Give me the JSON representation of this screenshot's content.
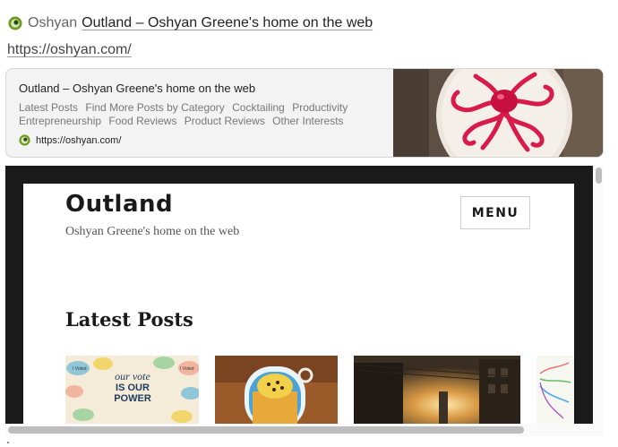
{
  "post": {
    "author": "Oshyan",
    "title": "Outland – Oshyan Greene's home on the web",
    "url": "https://oshyan.com/"
  },
  "onebox": {
    "title": "Outland – Oshyan Greene's home on the web",
    "categories": [
      "Latest Posts",
      "Find More Posts by Category",
      "Cocktailing",
      "Productivity",
      "Entrepreneurship",
      "Food Reviews",
      "Product Reviews",
      "Other Interests"
    ],
    "domain": "https://oshyan.com/",
    "image": "octopus-plate-image"
  },
  "embed": {
    "site_title": "Outland",
    "tagline": "Oshyan Greene's home on the web",
    "menu_label": "MENU",
    "section_heading": "Latest Posts",
    "thumb1_text": [
      "our vote",
      "IS OUR",
      "POWER"
    ],
    "sticker_text": "I Voted"
  },
  "colors": {
    "favicon_green": "#6a9a1f",
    "octopus_red": "#d81b4b",
    "embed_frame": "#1a1a1a"
  }
}
